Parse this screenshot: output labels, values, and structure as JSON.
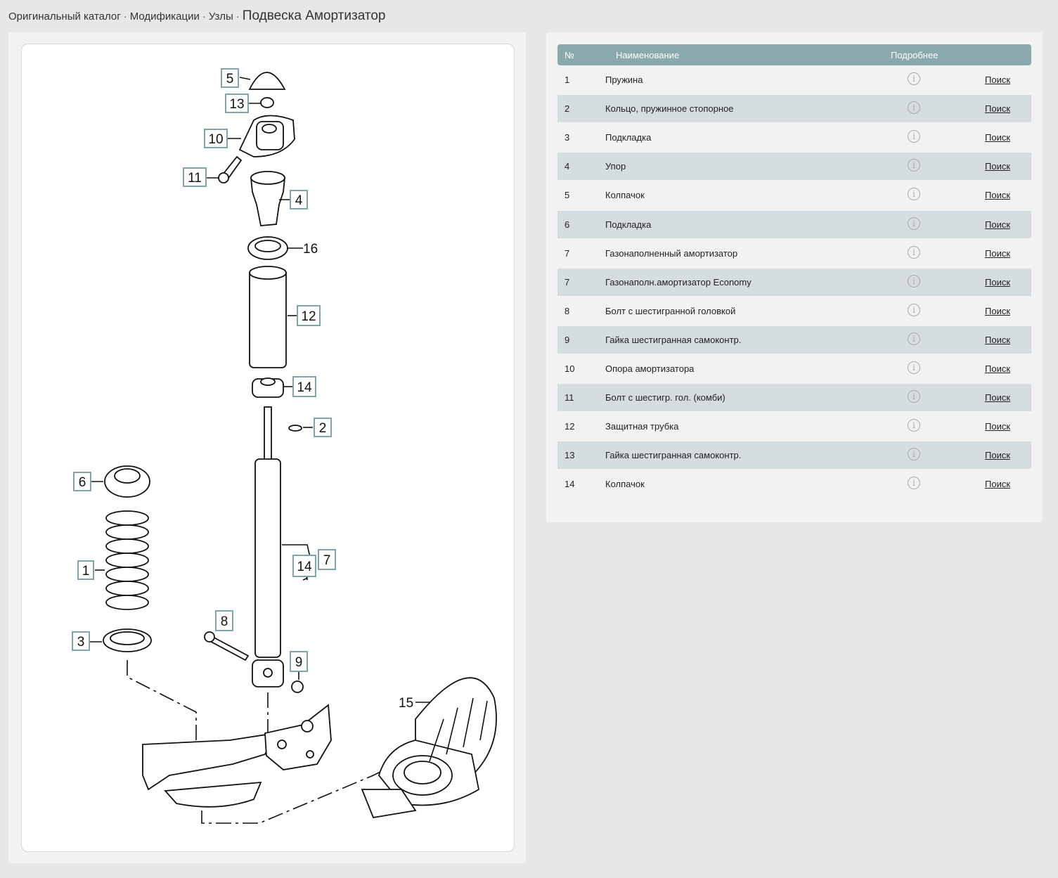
{
  "breadcrumb": {
    "items": [
      "Оригинальный каталог",
      "Модификации",
      "Узлы"
    ],
    "separator": "·",
    "current": "Подвеска Амортизатор"
  },
  "diagram": {
    "callouts": [
      "5",
      "13",
      "10",
      "11",
      "4",
      "16",
      "12",
      "14",
      "2",
      "6",
      "1",
      "7",
      "14",
      "8",
      "9",
      "3",
      "15"
    ]
  },
  "table": {
    "columns": {
      "number": "№",
      "name": "Наименование",
      "details": "Подробнее"
    },
    "info_icon": "info-circle-icon",
    "rows": [
      {
        "num": "1",
        "name": "Пружина",
        "link": "Поиск"
      },
      {
        "num": "2",
        "name": "Кольцо, пружинное стопорное",
        "link": "Поиск"
      },
      {
        "num": "3",
        "name": "Подкладка",
        "link": "Поиск"
      },
      {
        "num": "4",
        "name": "Упор",
        "link": "Поиск"
      },
      {
        "num": "5",
        "name": "Колпачок",
        "link": "Поиск"
      },
      {
        "num": "6",
        "name": "Подкладка",
        "link": "Поиск"
      },
      {
        "num": "7",
        "name": "Газонаполненный амортизатор",
        "link": "Поиск"
      },
      {
        "num": "7",
        "name": "Газонаполн.амортизатор Economy",
        "link": "Поиск"
      },
      {
        "num": "8",
        "name": "Болт с шестигранной головкой",
        "link": "Поиск"
      },
      {
        "num": "9",
        "name": "Гайка шестигранная самоконтр.",
        "link": "Поиск"
      },
      {
        "num": "10",
        "name": "Опора амортизатора",
        "link": "Поиск"
      },
      {
        "num": "11",
        "name": "Болт с шестигр. гол. (комби)",
        "link": "Поиск"
      },
      {
        "num": "12",
        "name": "Защитная трубка",
        "link": "Поиск"
      },
      {
        "num": "13",
        "name": "Гайка шестигранная самоконтр.",
        "link": "Поиск"
      },
      {
        "num": "14",
        "name": "Колпачок",
        "link": "Поиск"
      }
    ]
  },
  "colors": {
    "page_bg": "#e7e7e7",
    "panel_bg": "#f2f2f2",
    "header_bg": "#8aa9ad",
    "alt_row_bg": "#d5dde0",
    "callout_border": "#7fa5ab"
  }
}
